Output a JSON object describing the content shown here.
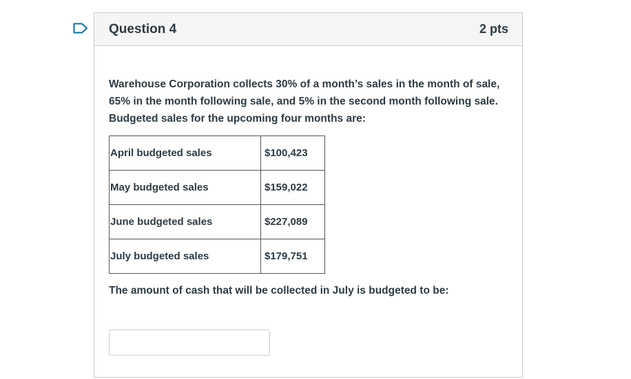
{
  "question": {
    "title": "Question 4",
    "points": "2 pts",
    "prompt": "Warehouse Corporation collects 30% of a month’s sales in the month of sale, 65% in the month following sale, and 5% in the second month following sale. Budgeted sales for the upcoming four months are:",
    "table": [
      {
        "label": "April budgeted sales",
        "amount": "$100,423"
      },
      {
        "label": "May budgeted sales",
        "amount": "$159,022"
      },
      {
        "label": "June budgeted sales",
        "amount": "$227,089"
      },
      {
        "label": "July budgeted sales",
        "amount": "$179,751"
      }
    ],
    "followup": "The amount of cash that will be collected in July is budgeted to be:",
    "answer": {
      "value": "",
      "placeholder": ""
    }
  },
  "icons": {
    "flag": "bookmark-flag-icon"
  },
  "colors": {
    "accent": "#0770a3",
    "border": "#c7cdd1",
    "header_bg": "#f5f5f5",
    "text": "#2d3b45"
  }
}
